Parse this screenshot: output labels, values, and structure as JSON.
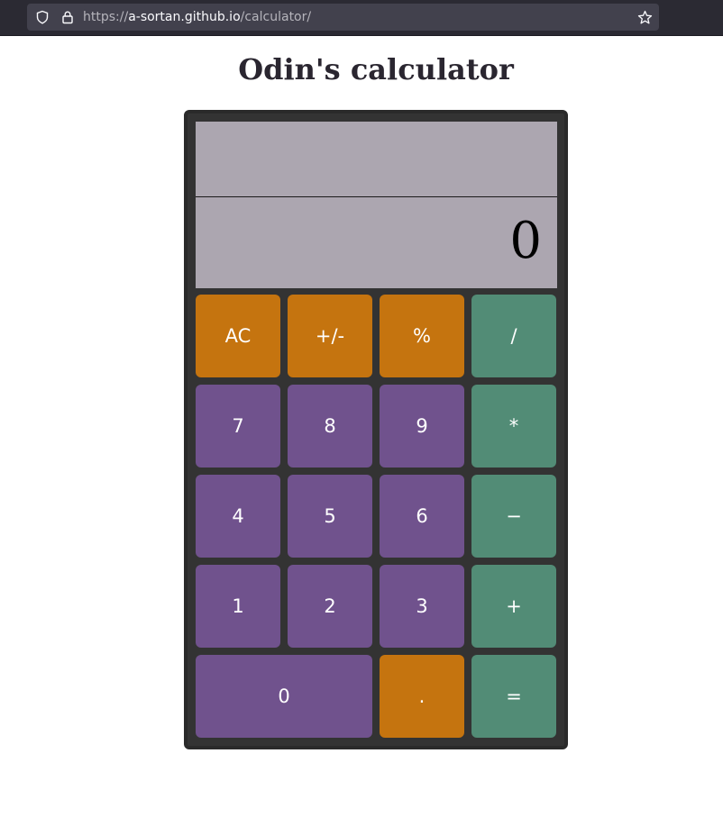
{
  "browser": {
    "url_scheme": "https://",
    "url_domain": "a-sortan.github.io",
    "url_path": "/calculator/",
    "icons": [
      "shield-icon",
      "lock-icon",
      "star-icon"
    ]
  },
  "page": {
    "title": "Odin's calculator"
  },
  "display": {
    "previous": "",
    "current": "0"
  },
  "keys": {
    "ac": "AC",
    "sign": "+/-",
    "percent": "%",
    "divide": "/",
    "seven": "7",
    "eight": "8",
    "nine": "9",
    "multiply": "*",
    "four": "4",
    "five": "5",
    "six": "6",
    "subtract": "−",
    "one": "1",
    "two": "2",
    "three": "3",
    "add": "+",
    "zero": "0",
    "decimal": ".",
    "equals": "="
  },
  "colors": {
    "function_key": "#c5740f",
    "number_key": "#70528d",
    "operator_key": "#528c76",
    "display_bg": "#aca6b0",
    "body_bg": "#333333"
  }
}
